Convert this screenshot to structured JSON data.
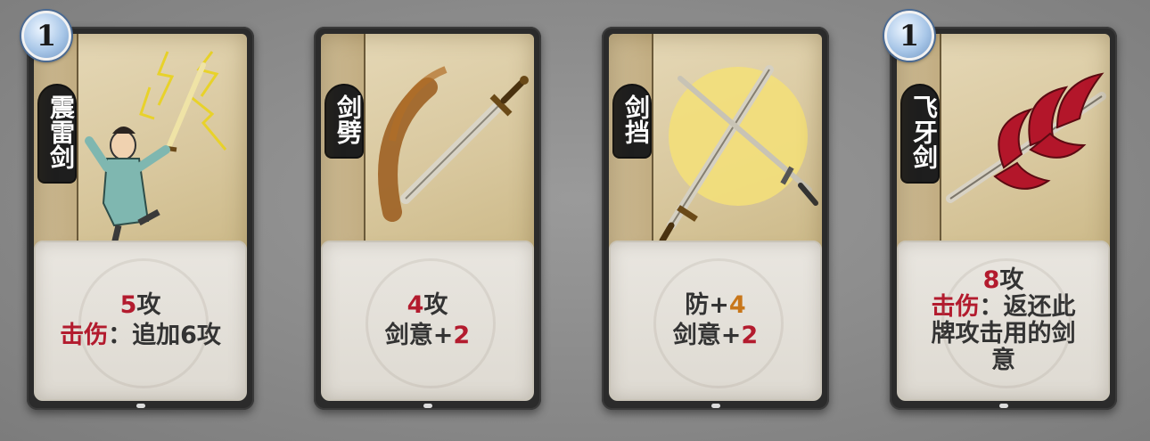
{
  "cards": [
    {
      "cost": "1",
      "has_badge": true,
      "title": "震雷剑",
      "art_icon": "lightning-swordsman-icon",
      "desc": {
        "line1_num": "5",
        "line1_text": "攻",
        "line2_kw": "击伤",
        "line2_text": "：追加6攻"
      }
    },
    {
      "cost": "",
      "has_badge": false,
      "title": "剑劈",
      "art_icon": "sword-slash-icon",
      "desc": {
        "line1_num": "4",
        "line1_text": "攻",
        "line2_text": "剑意+",
        "line2_num": "2"
      }
    },
    {
      "cost": "",
      "has_badge": false,
      "title": "剑挡",
      "art_icon": "crossed-swords-icon",
      "desc": {
        "line1_text": "防+",
        "line1_num": "4",
        "line2_text": "剑意+",
        "line2_num": "2"
      }
    },
    {
      "cost": "1",
      "has_badge": true,
      "title": "飞牙剑",
      "art_icon": "red-flying-sword-icon",
      "desc": {
        "line1_num": "8",
        "line1_text": "攻",
        "line2_kw": "击伤",
        "line2_text": "：返还此",
        "line3_text": "牌攻击用的剑",
        "line4_text": "意"
      }
    }
  ],
  "colors": {
    "keyword": "#b31b2e",
    "orange_number": "#c8761a",
    "card_frame": "#2b2b2b",
    "background": "#8a8a8a"
  }
}
